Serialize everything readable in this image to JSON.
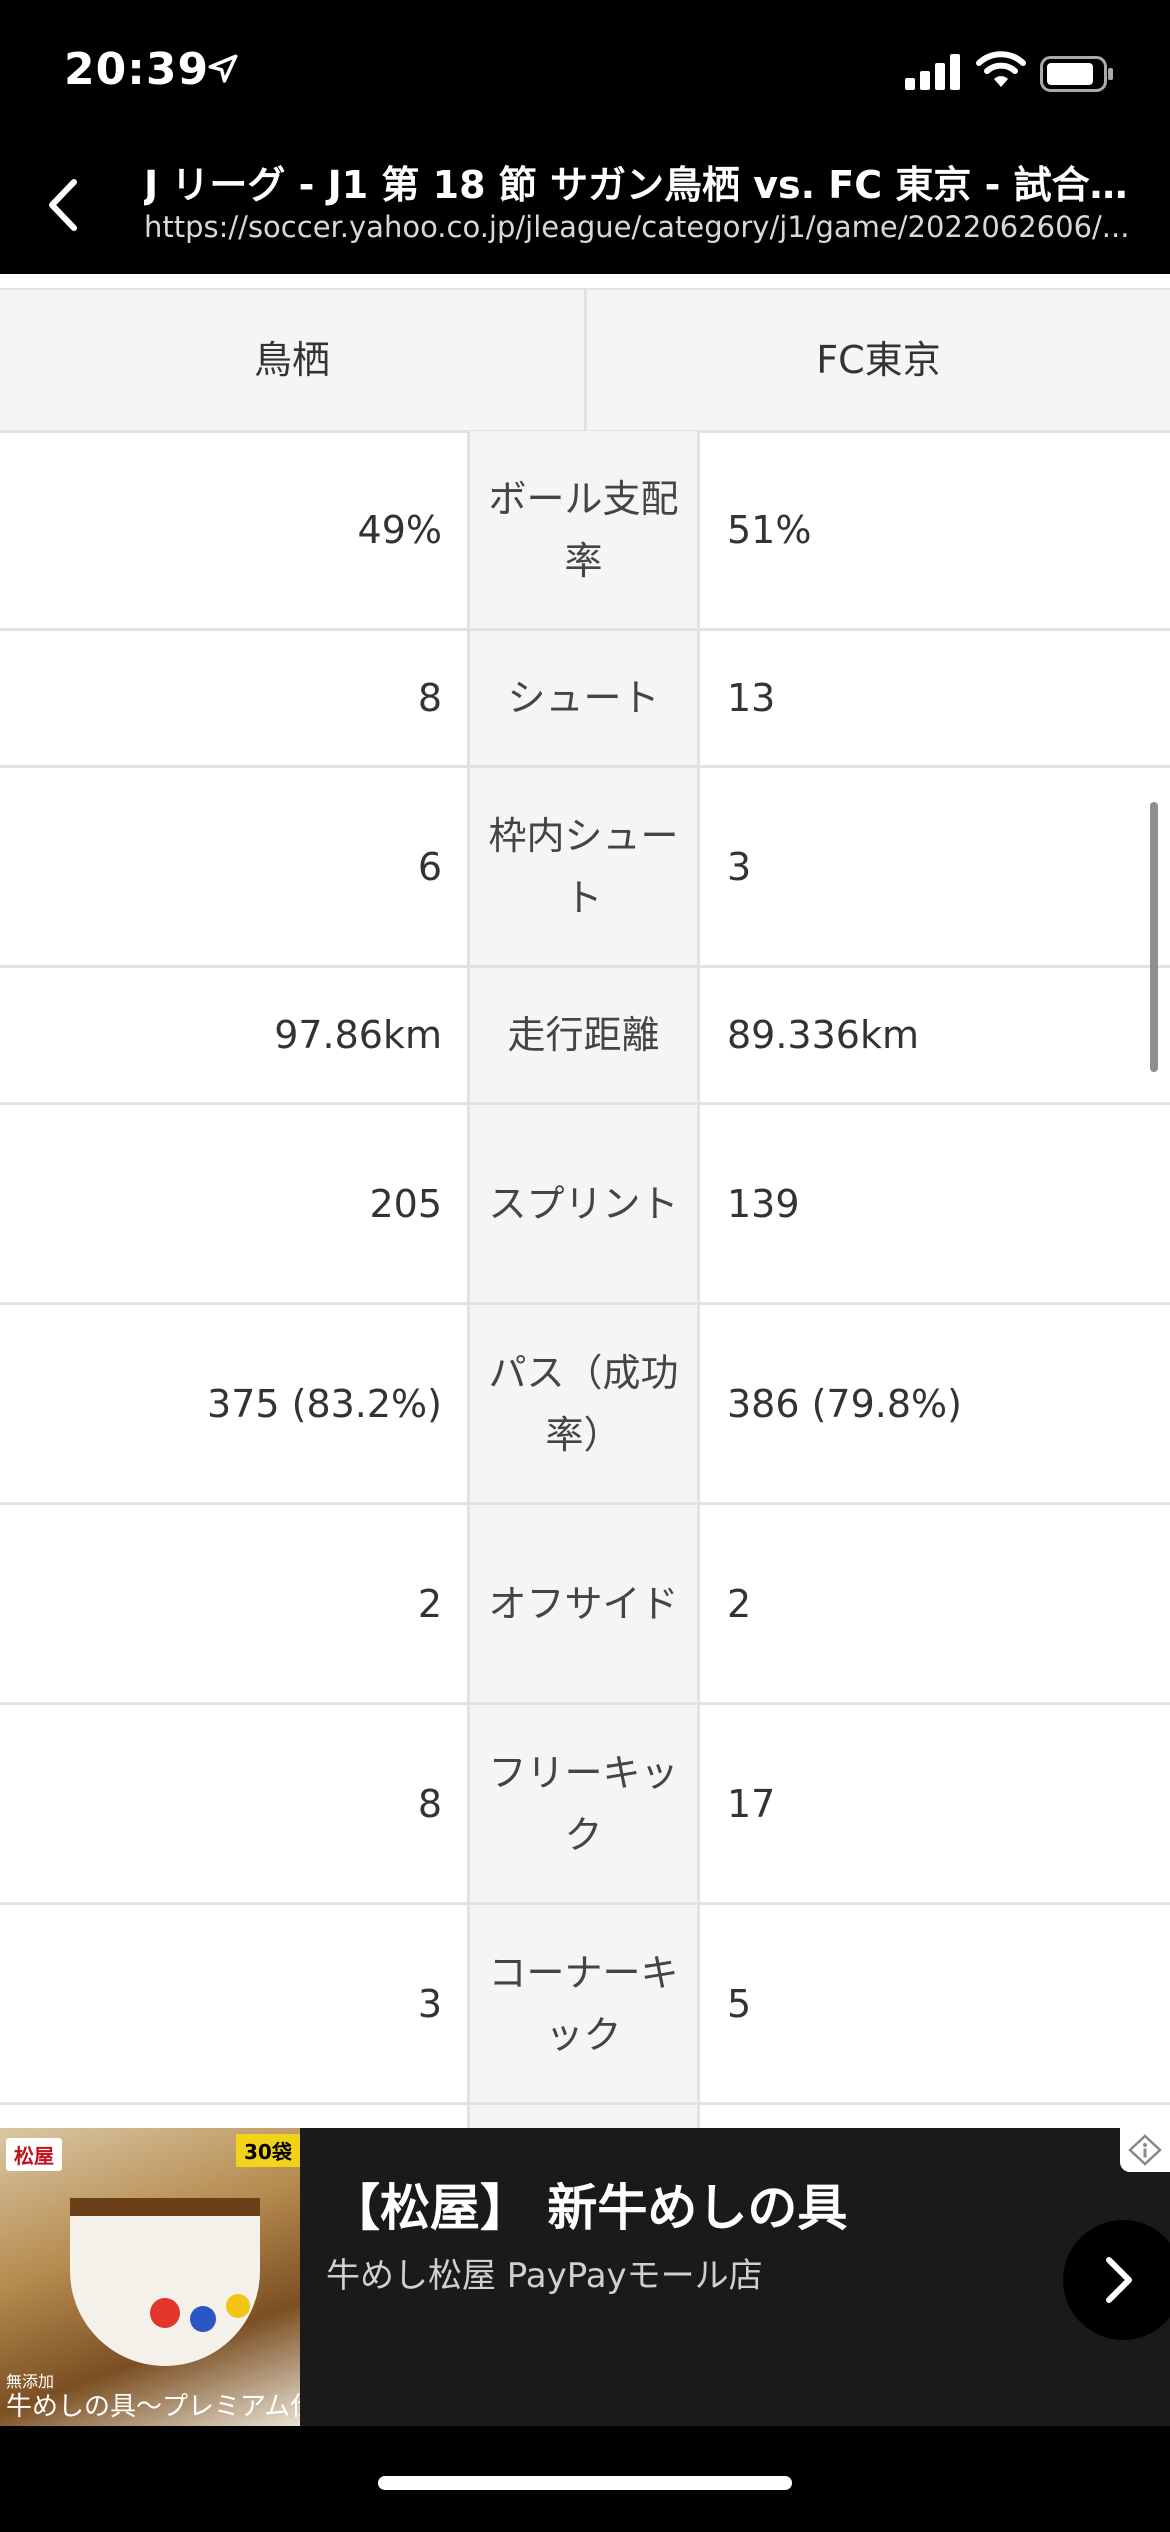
{
  "status_bar": {
    "time": "20:39"
  },
  "nav": {
    "title": "J リーグ - J1 第 18 節 サガン鳥栖 vs. FC 東京 - 試合…",
    "url": "https://soccer.yahoo.co.jp/jleague/category/j1/game/2022062606/..."
  },
  "teams": {
    "home": "鳥栖",
    "away": "FC東京"
  },
  "stats": [
    {
      "label": "ボール支配率",
      "home": "49%",
      "away": "51%"
    },
    {
      "label": "シュート",
      "home": "8",
      "away": "13"
    },
    {
      "label": "枠内シュート",
      "home": "6",
      "away": "3"
    },
    {
      "label": "走行距離",
      "home": "97.86km",
      "away": "89.336km"
    },
    {
      "label": "スプリント",
      "home": "205",
      "away": "139"
    },
    {
      "label": "パス（成功率）",
      "home": "375 (83.2%)",
      "away": "386 (79.8%)"
    },
    {
      "label": "オフサイド",
      "home": "2",
      "away": "2"
    },
    {
      "label": "フリーキック",
      "home": "8",
      "away": "17"
    },
    {
      "label": "コーナーキック",
      "home": "3",
      "away": "5"
    }
  ],
  "ad": {
    "title": "【松屋】 新牛めしの具",
    "subtitle": "牛めし松屋 PayPayモール店",
    "logo": "松屋",
    "badge": "30袋",
    "caption_small": "無添加",
    "caption": "牛めしの具〜プレミアム仕様〜"
  },
  "icons": {
    "location": "location-arrow-icon",
    "signal": "cellular-signal-icon",
    "wifi": "wifi-icon",
    "battery": "battery-icon",
    "back": "chevron-left-icon",
    "next": "chevron-right-icon",
    "adchoices": "adchoices-icon"
  }
}
